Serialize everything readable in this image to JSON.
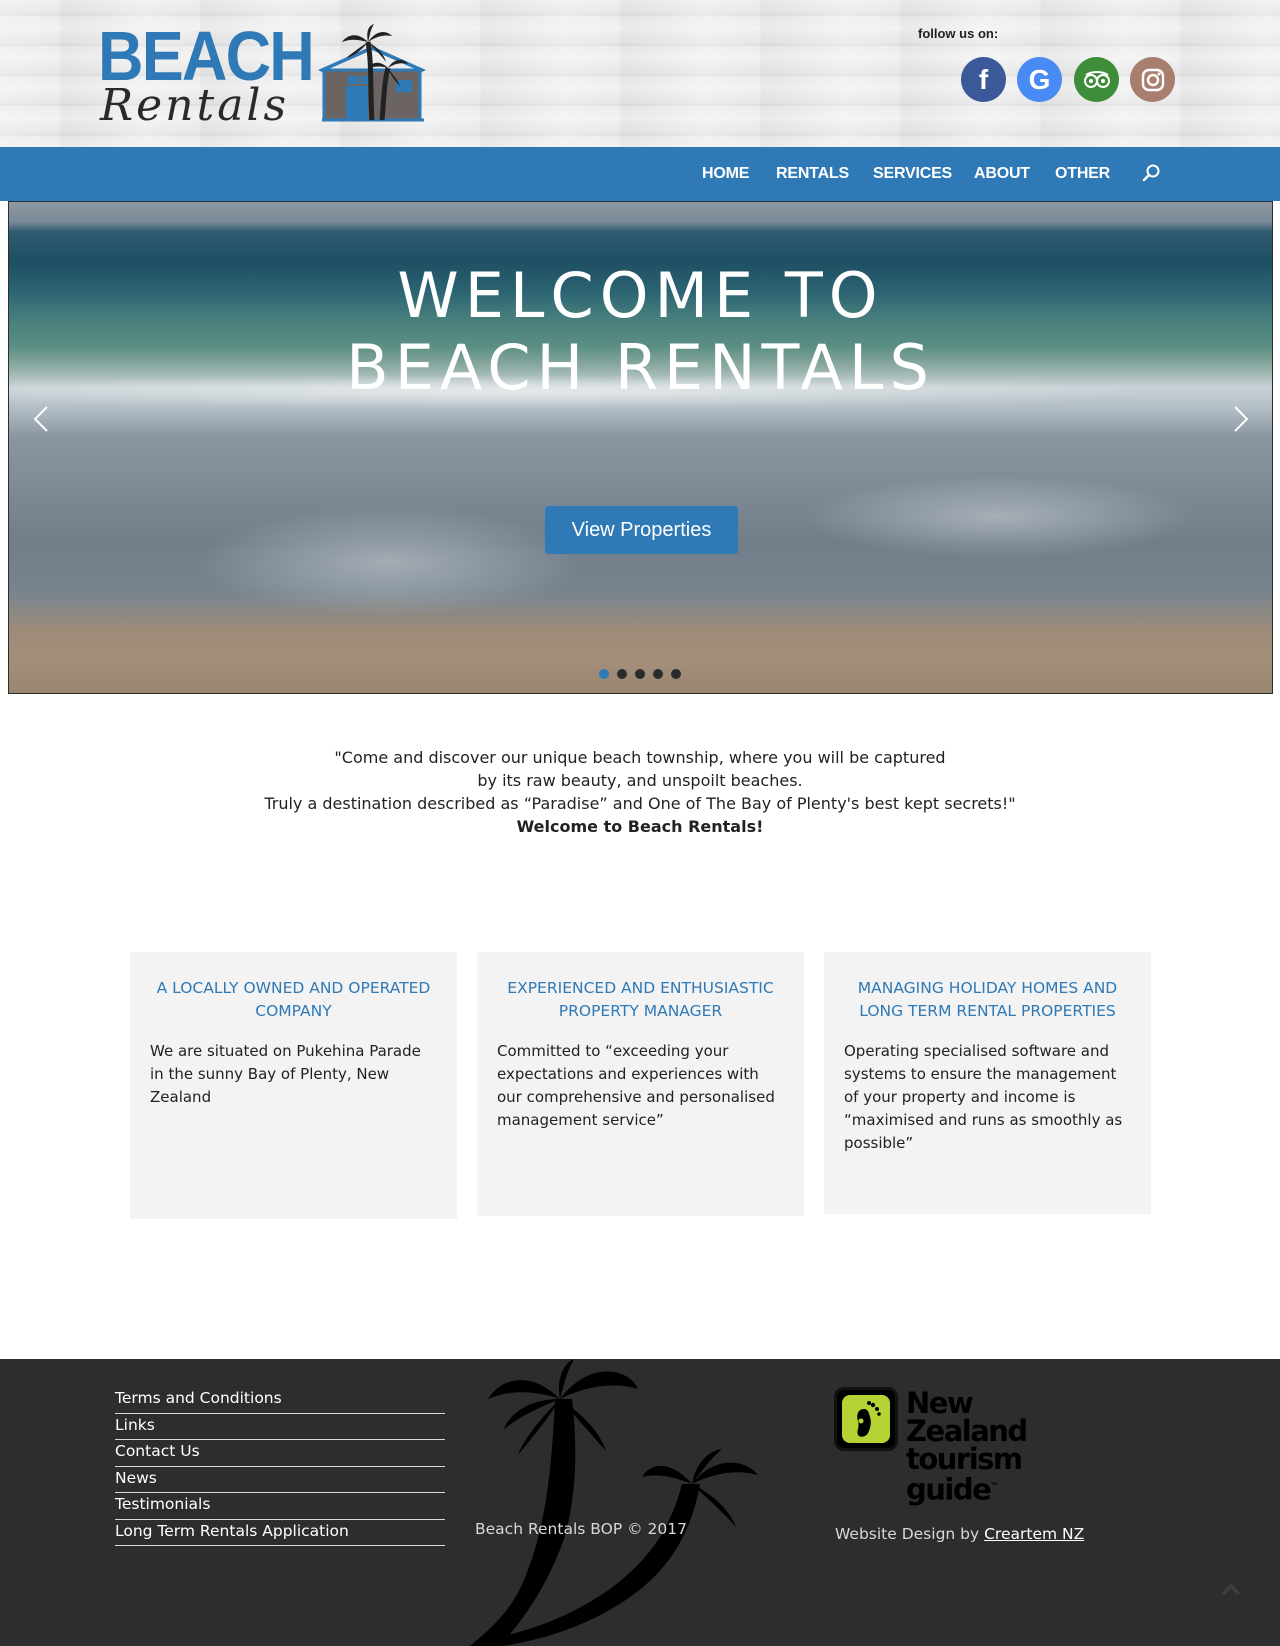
{
  "header": {
    "logo_top": "BEACH",
    "logo_bottom": "Rentals",
    "follow_label": "follow us on:",
    "social": [
      {
        "name": "facebook",
        "glyph": "f",
        "color": "#3b5999"
      },
      {
        "name": "google",
        "glyph": "G",
        "color": "#4a8af4"
      },
      {
        "name": "tripadvisor",
        "glyph": "oo",
        "color": "#3e8d3b"
      },
      {
        "name": "instagram",
        "glyph": "◎",
        "color": "#a87e6e"
      }
    ]
  },
  "nav": {
    "items": [
      "HOME",
      "RENTALS",
      "SERVICES",
      "ABOUT",
      "OTHER"
    ],
    "search_icon": "search-icon"
  },
  "hero": {
    "title_line1": "WELCOME TO",
    "title_line2": "BEACH RENTALS",
    "button_label": "View Properties",
    "slide_count": 5,
    "active_slide": 1
  },
  "intro": {
    "line1": "\"Come and discover our unique beach township,  where you will be captured",
    "line2": "by its raw beauty, and unspoilt beaches.",
    "line3": "Truly a destination described as “Paradise” and  One of The Bay of Plenty's best kept secrets!\"",
    "line4": "Welcome to Beach Rentals!"
  },
  "cards": [
    {
      "title": "A LOCALLY OWNED AND OPERATED COMPANY",
      "body": "We are situated on Pukehina Parade in the sunny Bay of Plenty, New Zealand"
    },
    {
      "title": "EXPERIENCED AND ENTHUSIASTIC PROPERTY MANAGER",
      "body": "Committed to “exceeding your expectations and experiences with our comprehensive and personalised management service”"
    },
    {
      "title": "MANAGING HOLIDAY HOMES  AND LONG TERM RENTAL PROPERTIES",
      "body": "Operating specialised software and systems to ensure the management of your property and income is “maximised and runs as smoothly as possible”"
    }
  ],
  "footer": {
    "links": [
      "Terms and Conditions",
      "Links",
      "Contact Us",
      "News",
      "Testimonials",
      "Long Term Rentals Application"
    ],
    "copyright": "Beach Rentals BOP © 2017",
    "nz_logo_line1": "New Zealand",
    "nz_logo_line2": "tourism guide",
    "nz_logo_tm": "™",
    "credit_prefix": "Website Design by ",
    "credit_link": "Creartem NZ"
  },
  "colors": {
    "brand_blue": "#2f79b6",
    "footer_bg": "#2d2c2e",
    "card_bg": "#f3f3f3"
  }
}
